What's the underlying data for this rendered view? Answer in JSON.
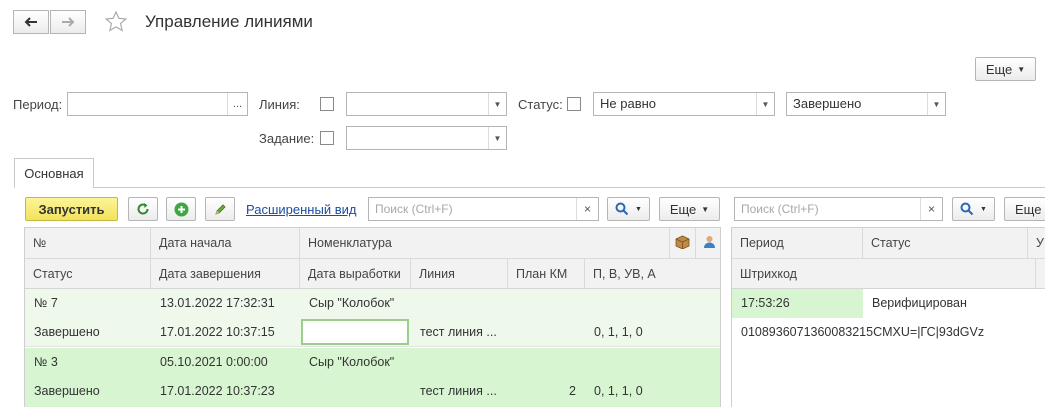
{
  "window": {
    "title": "Управление линиями"
  },
  "header": {
    "more_label": "Еще"
  },
  "filters": {
    "period_label": "Период:",
    "period_value": "",
    "period_button": "...",
    "line_label": "Линия:",
    "line_value": "",
    "status_label": "Статус:",
    "status_condition": "Не равно",
    "status_value": "Завершено",
    "task_label": "Задание:",
    "task_value": ""
  },
  "tabs": [
    {
      "label": "Основная"
    }
  ],
  "toolbar": {
    "run_label": "Запустить",
    "extended_view_link": "Расширенный вид",
    "search_placeholder": "Поиск (Ctrl+F)",
    "more_label": "Еще"
  },
  "right_toolbar": {
    "search_placeholder": "Поиск (Ctrl+F)",
    "more_label": "Еще"
  },
  "left_table": {
    "header_row1": [
      "№",
      "Дата начала",
      "Номенклатура"
    ],
    "header_row2": [
      "Статус",
      "Дата завершения",
      "Дата выработки",
      "Линия",
      "План КМ",
      "П, В, УВ, А"
    ],
    "rows": [
      {
        "number": "№ 7",
        "start": "13.01.2022 17:32:31",
        "nomenclature": "Сыр \"Колобок\"",
        "status": "Завершено",
        "end": "17.01.2022 10:37:15",
        "production_date": "",
        "line": "тест линия ...",
        "plan": "",
        "pvuva": "0, 1, 1, 0"
      },
      {
        "number": "№ 3",
        "start": "05.10.2021 0:00:00",
        "nomenclature": "Сыр \"Колобок\"",
        "status": "Завершено",
        "end": "17.01.2022 10:37:23",
        "production_date": "",
        "line": "тест линия ...",
        "plan": "2",
        "pvuva": "0, 1, 1, 0"
      }
    ]
  },
  "right_table": {
    "header_row1": [
      "Период",
      "Статус",
      "У"
    ],
    "header_row2": [
      "Штрихкод"
    ],
    "rows": [
      {
        "time": "17:53:26",
        "status": "Верифицирован",
        "barcode": "0108936071360083215CMXU=|ГС|93dGVz"
      }
    ]
  },
  "colors": {
    "selected_row": "#d7f5d1",
    "row_tint": "#eef9ec",
    "accent_yellow": "#f2e35b",
    "link": "#1a4d9c"
  }
}
